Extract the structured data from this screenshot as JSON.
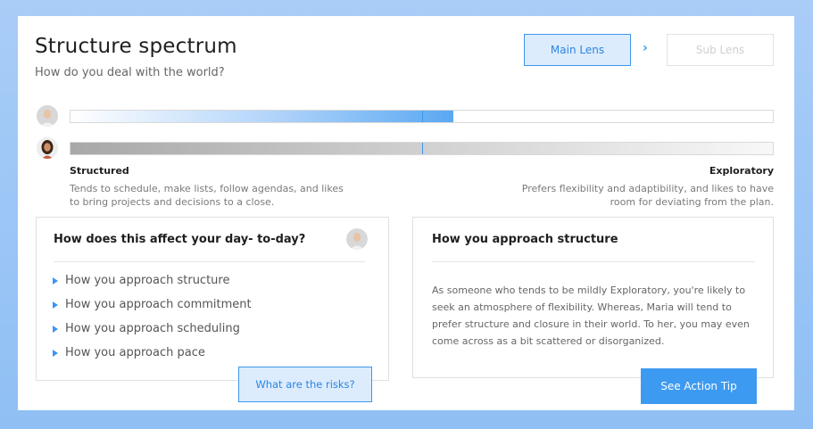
{
  "header": {
    "title": "Structure spectrum",
    "subtitle": "How do you deal with the world?"
  },
  "lens": {
    "main_label": "Main Lens",
    "sub_label": "Sub Lens",
    "separator_icon": "chevron-right-icon"
  },
  "spectrum": {
    "bars": [
      {
        "person": "man",
        "position_fraction": 0.54,
        "colors": [
          "#ffffff",
          "#5aa8f2"
        ]
      },
      {
        "person": "woman",
        "position_fraction": 0.5,
        "colors": [
          "#a8a8a8",
          "#f8f8f8"
        ]
      }
    ],
    "midline_color": "#3d96f0",
    "left_pole": {
      "title": "Structured",
      "description": "Tends to schedule, make lists, follow agendas, and likes to bring projects and decisions to a close."
    },
    "right_pole": {
      "title": "Exploratory",
      "description": "Prefers flexibility and adaptibility, and likes to have room for deviating from the plan."
    }
  },
  "left_card": {
    "heading": "How does this affect your day- to-day?",
    "items": [
      "How you approach structure",
      "How you approach commitment",
      "How you approach scheduling",
      "How you approach pace"
    ]
  },
  "right_card": {
    "heading": "How you approach structure",
    "body": "As someone who tends to be mildly Exploratory, you're likely to seek an atmosphere of flexibility. Whereas, Maria will tend to prefer structure and closure in their world. To her, you may even come across as a bit scattered or disorganized."
  },
  "buttons": {
    "risks_label": "What are the risks?",
    "action_label": "See Action Tip"
  },
  "colors": {
    "accent": "#3d96f0",
    "accent_light": "#dcecfd",
    "action": "#3d9af1",
    "background": "#a9cdf7"
  }
}
